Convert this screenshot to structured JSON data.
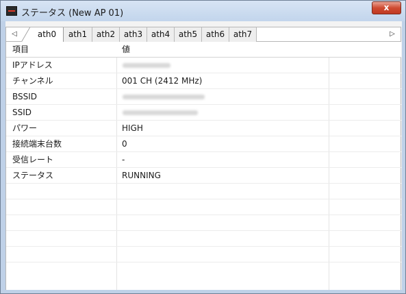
{
  "window": {
    "title": "ステータス (New AP 01)",
    "close_label": "x"
  },
  "tabs": {
    "scroll_left": "◁",
    "scroll_right": "▷",
    "items": [
      {
        "label": "ath0",
        "active": true
      },
      {
        "label": "ath1",
        "active": false
      },
      {
        "label": "ath2",
        "active": false
      },
      {
        "label": "ath3",
        "active": false
      },
      {
        "label": "ath4",
        "active": false
      },
      {
        "label": "ath5",
        "active": false
      },
      {
        "label": "ath6",
        "active": false
      },
      {
        "label": "ath7",
        "active": false
      }
    ]
  },
  "table": {
    "headers": {
      "name": "項目",
      "value": "値"
    },
    "rows": [
      {
        "name": "IPアドレス",
        "value": "",
        "redacted": true
      },
      {
        "name": "チャンネル",
        "value": "001 CH (2412 MHz)",
        "redacted": false
      },
      {
        "name": "BSSID",
        "value": "",
        "redacted": true
      },
      {
        "name": "SSID",
        "value": "",
        "redacted": true
      },
      {
        "name": "パワー",
        "value": "HIGH",
        "redacted": false
      },
      {
        "name": "接続端末台数",
        "value": "0",
        "redacted": false
      },
      {
        "name": "受信レート",
        "value": "-",
        "redacted": false
      },
      {
        "name": "ステータス",
        "value": "RUNNING",
        "redacted": false
      }
    ],
    "empty_rows": 5
  },
  "colors": {
    "window_frame": "#bfd1e8",
    "close_button": "#cf4b32"
  }
}
